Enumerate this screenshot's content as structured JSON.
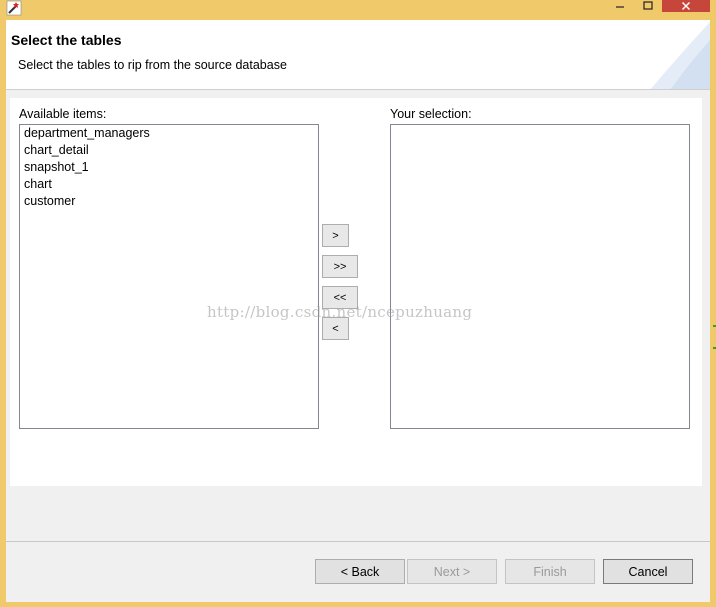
{
  "header": {
    "title": "Select the tables",
    "description": "Select the tables to rip from the source database"
  },
  "available": {
    "label": "Available items:",
    "items": [
      "department_managers",
      "chart_detail",
      "snapshot_1",
      "chart",
      "customer"
    ]
  },
  "selection": {
    "label": "Your selection:",
    "items": []
  },
  "transfer_buttons": {
    "add": ">",
    "add_all": ">>",
    "remove_all": "<<",
    "remove": "<"
  },
  "watermark": "http://blog.csdn.net/ncepuzhuang",
  "footer": {
    "back": "< Back",
    "next": "Next >",
    "finish": "Finish",
    "cancel": "Cancel"
  },
  "icons": {
    "app": "wand-icon",
    "minimize": "minimize-icon",
    "maximize": "maximize-icon",
    "close": "close-icon"
  },
  "colors": {
    "frame": "#f0c96a",
    "close": "#c7463b",
    "dialog": "#f0f0f0"
  }
}
